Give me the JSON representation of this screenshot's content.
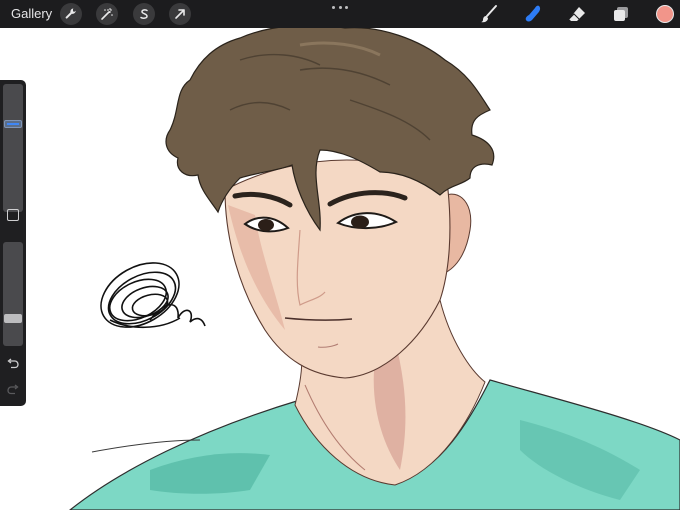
{
  "toolbar": {
    "gallery_label": "Gallery",
    "left_tools": [
      {
        "name": "actions",
        "icon": "wrench-icon"
      },
      {
        "name": "adjustments",
        "icon": "magic-wand-icon"
      },
      {
        "name": "selection",
        "icon": "selection-s-icon"
      },
      {
        "name": "transform",
        "icon": "arrow-cursor-icon"
      }
    ],
    "more_icon": "more-dots-icon",
    "right_tools": [
      {
        "name": "brush",
        "icon": "brush-icon",
        "active": false
      },
      {
        "name": "smudge",
        "icon": "smudge-finger-icon",
        "active": true
      },
      {
        "name": "eraser",
        "icon": "eraser-icon",
        "active": false
      },
      {
        "name": "layers",
        "icon": "layers-icon",
        "active": false
      }
    ],
    "current_color": "#f2958a",
    "active_tool_color": "#2d7cf6"
  },
  "sidebar": {
    "brush_size_level": 0.7,
    "brush_opacity_level": 0.25,
    "modify_icon": "square-icon",
    "undo_icon": "undo-icon",
    "redo_icon": "redo-icon"
  },
  "canvas": {
    "background": "#ffffff",
    "skin_color": "#f4d8c4",
    "hair_color": "#6f5d48",
    "shirt_color": "#7dd8c5"
  }
}
